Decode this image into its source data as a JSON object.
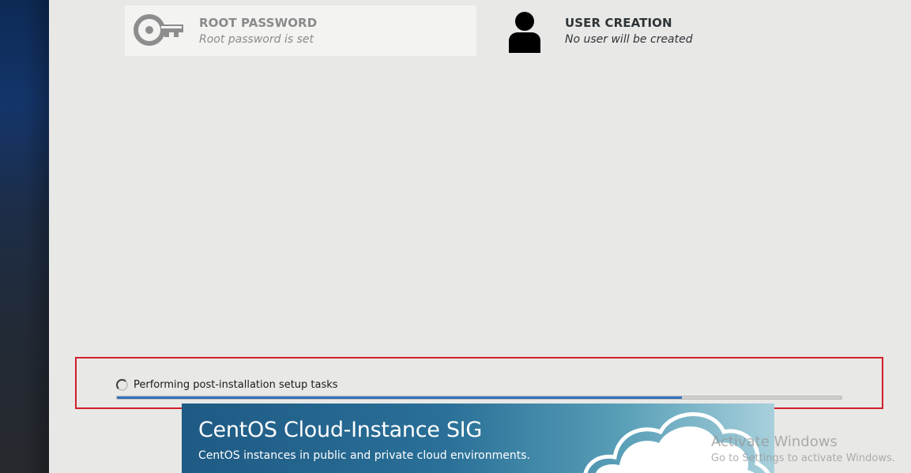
{
  "spokes": {
    "root_password": {
      "title": "ROOT PASSWORD",
      "status": "Root password is set",
      "icon": "key-icon"
    },
    "user_creation": {
      "title": "USER CREATION",
      "status": "No user will be created",
      "icon": "user-icon"
    }
  },
  "progress": {
    "status_text": "Performing post-installation setup tasks",
    "percent": 78,
    "highlight_color": "#d0202a",
    "fill_color": "#1f5ea8"
  },
  "banner": {
    "title": "CentOS Cloud-Instance SIG",
    "subtitle": "CentOS instances in public and private cloud environments.",
    "icon": "cloud-icon"
  },
  "watermark": {
    "title": "Activate Windows",
    "subtitle": "Go to Settings to activate Windows."
  }
}
